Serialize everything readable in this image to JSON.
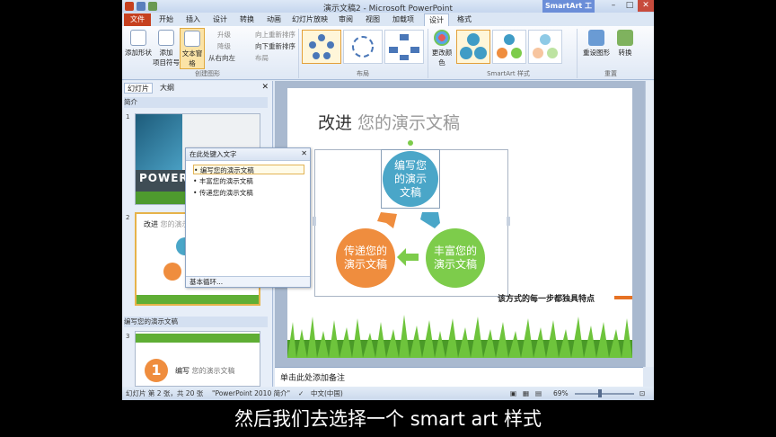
{
  "window": {
    "title": "演示文稿2 - Microsoft PowerPoint",
    "context_tab": "SmartArt 工具"
  },
  "tabs": [
    "文件",
    "开始",
    "插入",
    "设计",
    "转换",
    "动画",
    "幻灯片放映",
    "审阅",
    "视图",
    "加载项",
    "设计",
    "格式"
  ],
  "ribbon": {
    "create": {
      "add_shape": "添加形状",
      "add_bullet_1": "添加",
      "add_bullet_2": "项目符号",
      "text_pane": "文本窗格",
      "promote": "升级",
      "demote": "降级",
      "rtl": "从右向左",
      "move_up": "向上重新排序",
      "move_down": "向下重新排序",
      "layout": "布局",
      "label": "创建图形"
    },
    "layout_label": "布局",
    "styles": {
      "change_colors": "更改颜色",
      "label": "SmartArt 样式"
    },
    "reset": {
      "reset_graphic": "重设图形",
      "convert": "转换",
      "label": "重置"
    }
  },
  "left_pane": {
    "tab_slides": "幻灯片",
    "tab_outline": "大纲",
    "section1": "简介",
    "section2": "编写您的演示文稿",
    "thumb1_text": "POWERP",
    "thumb2_title_a": "改进",
    "thumb2_title_b": "您的演示",
    "thumb3_text_a": "编写",
    "thumb3_text_b": "您的演示文稿",
    "thumb3_number": "1",
    "slide_nums": [
      "1",
      "2",
      "3"
    ]
  },
  "text_pane": {
    "header": "在此处键入文字",
    "items": [
      "编写您的演示文稿",
      "丰富您的演示文稿",
      "传递您的演示文稿"
    ],
    "footer": "基本循环..."
  },
  "slide": {
    "title_a": "改进",
    "title_b": " 您的演示文稿",
    "circle_top": "编写您的演示文稿",
    "circle_right": "丰富您的演示文稿",
    "circle_left": "传递您的演示文稿",
    "caption": "该方式的每一步都独具特点"
  },
  "notes": "单击此处添加备注",
  "status": {
    "slide": "幻灯片 第 2 张，共 20 张",
    "theme": "\"PowerPoint 2010 简介\"",
    "lang": "中文(中国)",
    "zoom": "69%"
  },
  "caption_subtitle": "然后我们去选择一个 smart art 样式",
  "colors": {
    "blue": "#4aa6c8",
    "green": "#7dcc4b",
    "orange": "#ef8d3e",
    "file_tab": "#c6401f"
  }
}
